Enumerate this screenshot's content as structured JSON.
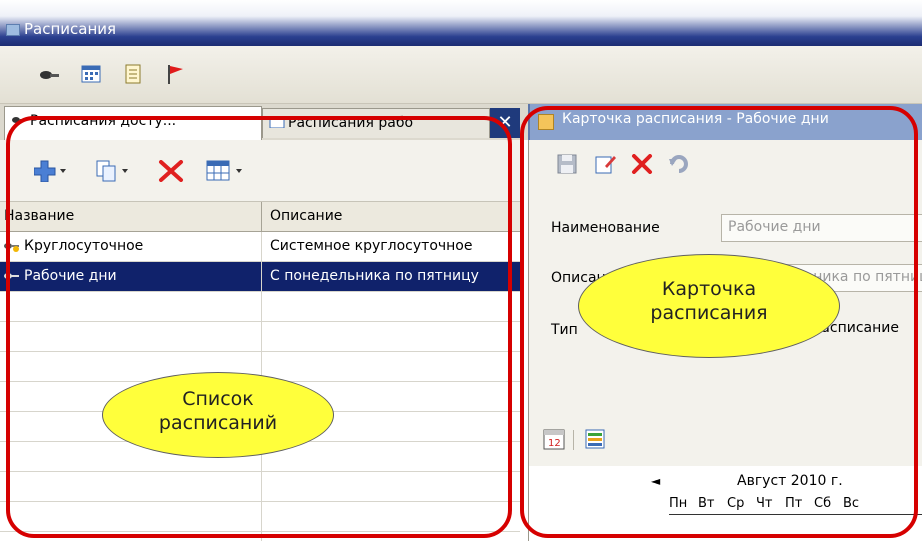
{
  "window": {
    "title": "Расписания"
  },
  "main_toolbar": {
    "icons": [
      "key-icon",
      "calendar-icon",
      "document-icon",
      "flag-icon"
    ]
  },
  "tabs": [
    {
      "label": "Расписания досту...",
      "icon": "key-icon",
      "active": true
    },
    {
      "label": "Расписания рабо",
      "icon": "calendar-icon",
      "active": false
    }
  ],
  "card_tab": {
    "label": "Карточка расписания - Рабочие дни"
  },
  "list_toolbar": {
    "icons": [
      "add-icon",
      "copy-icon",
      "delete-icon",
      "grid-icon"
    ]
  },
  "grid": {
    "columns": [
      "Название",
      "Описание"
    ],
    "rows": [
      {
        "name": "Круглосуточное",
        "description": "Системное круглосуточное",
        "selected": false
      },
      {
        "name": "Рабочие дни",
        "description": "С понедельника по пятницу",
        "selected": true
      }
    ]
  },
  "card": {
    "toolbar_icons": [
      "save-icon",
      "edit-icon",
      "delete-icon",
      "undo-icon"
    ],
    "fields": [
      {
        "label": "Наименование",
        "value": "Рабочие дни"
      },
      {
        "label": "Описание",
        "value": "С понедельника по пятницу"
      },
      {
        "label": "Тип",
        "value": "Недельное расписание"
      }
    ],
    "calendar": {
      "month": "Август 2010 г.",
      "weekdays": [
        "Пн",
        "Вт",
        "Ср",
        "Чт",
        "Пт",
        "Сб",
        "Вс"
      ]
    }
  },
  "annotations": {
    "left": "Список расписаний",
    "right": "Карточка расписания",
    "ring_color": "#d60000",
    "callout_color": "#ffff3b"
  }
}
